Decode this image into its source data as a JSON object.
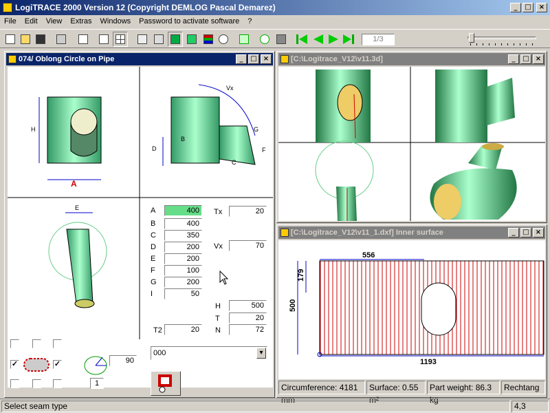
{
  "window": {
    "title": "LogiTRACE 2000  Version 12  (Copyright DEMLOG Pascal Demarez)"
  },
  "menu": [
    "File",
    "Edit",
    "View",
    "Extras",
    "Windows",
    "Password to activate software",
    "?"
  ],
  "toolbar": {
    "page": "1/3"
  },
  "left_window": {
    "title": "074/ Oblong Circle on Pipe",
    "dim_labels": {
      "H": "H",
      "A": "A",
      "D": "D",
      "B": "B",
      "C": "C",
      "G": "G",
      "F": "F",
      "Vx": "Vx",
      "E": "E"
    }
  },
  "params": [
    {
      "label": "A",
      "value": "400"
    },
    {
      "label": "B",
      "value": "400"
    },
    {
      "label": "C",
      "value": "350"
    },
    {
      "label": "D",
      "value": "200"
    },
    {
      "label": "E",
      "value": "200"
    },
    {
      "label": "F",
      "value": "100"
    },
    {
      "label": "G",
      "value": "200"
    },
    {
      "label": "I",
      "value": "50"
    }
  ],
  "right_params": {
    "tx": {
      "label": "Tx",
      "value": "20"
    },
    "vx": {
      "label": "Vx",
      "value": "70"
    },
    "h": {
      "label": "H",
      "value": "500"
    },
    "t": {
      "label": "T",
      "value": "20"
    },
    "n": {
      "label": "N",
      "value": "72"
    },
    "t2": {
      "label": "T2",
      "value": "20"
    }
  },
  "angle": {
    "value": "90",
    "count": "1"
  },
  "combo": {
    "value": "000"
  },
  "view3d": {
    "title": "[C:\\Logitrace_V12\\v11.3d]"
  },
  "dxf": {
    "title": "[C:\\Logitrace_V12\\v11_1.dxf]  Inner surface",
    "dims": {
      "w": "556",
      "h": "179",
      "total_h": "500",
      "total_w": "1193"
    }
  },
  "info": {
    "circumference": "Circumference: 4181 mm",
    "surface": "Surface: 0.55 m²",
    "weight": "Part weight: 86.3 kg",
    "shape": "Rechtang"
  },
  "status": {
    "text": "Select seam type",
    "pos": "4,3"
  },
  "colors": {
    "pipe": "#66dd99",
    "dim": "#0000cc",
    "seam": "#cc0000",
    "title": "#0a246a"
  }
}
